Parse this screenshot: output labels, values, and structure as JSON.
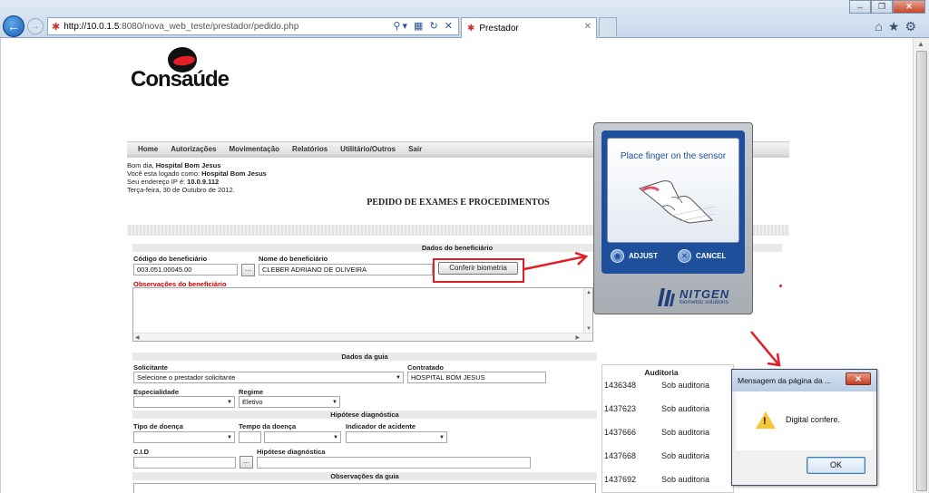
{
  "browser": {
    "url_host": "http://10.0.1.5",
    "url_rest": ":8080/nova_web_teste/prestador/pedido.php",
    "tab_title": "Prestador",
    "tab_close": "✕",
    "icons": [
      "back-arrow",
      "forward-arrow",
      "search",
      "compatibility",
      "refresh",
      "home",
      "favorites",
      "tools"
    ]
  },
  "logo": {
    "text": "Consaúde"
  },
  "nav": [
    "Home",
    "Autorizações",
    "Movimentação",
    "Relatórios",
    "Utilitário/Outros",
    "Sair"
  ],
  "greeting": {
    "line1_prefix": "Bom dia, ",
    "line1_name": "Hospital Bom Jesus",
    "line2_prefix": "Você esta logado como: ",
    "line2_name": "Hospital Bom Jesus",
    "line3_prefix": "Seu endereço IP é: ",
    "line3_ip": "10.0.9.112",
    "line4": "Terça-feira, 30 de Outubro de 2012."
  },
  "page_title": "PEDIDO DE EXAMES E PROCEDIMENTOS",
  "beneficiario": {
    "section_title": "Dados do beneficiário",
    "codigo_label": "Código do beneficiário",
    "codigo_value": "003.051.00045.00",
    "nome_label": "Nome do beneficiário",
    "nome_value": "CLEBER ADRIANO DE OLIVEIRA",
    "dots": "...",
    "verify_button": "Conferir biometria",
    "obs_label": "Observações do beneficiário"
  },
  "guia": {
    "section_title": "Dados da guia",
    "solicitante_label": "Solicitante",
    "solicitante_value": "Selecione o prestador solicitante",
    "contratado_label": "Contratado",
    "contratado_value": "HOSPITAL BOM JESUS",
    "especialidade_label": "Especialidade",
    "regime_label": "Regime",
    "regime_value": "Eletivo"
  },
  "hipotese": {
    "section_title": "Hipótese diagnóstica",
    "tipo_label": "Tipo de doença",
    "tempo_label": "Tempo da doença",
    "indicador_label": "Indicador de acidente",
    "cid_label": "C.I.D",
    "hipotese_label": "Hipótese diagnóstica",
    "dots": "..."
  },
  "obs_guia": {
    "section_title": "Observações da guia"
  },
  "biometric": {
    "prompt": "Place finger on the sensor",
    "adjust": "ADJUST",
    "cancel": "CANCEL",
    "brand": "NITGEN",
    "tagline": "biometric solutions"
  },
  "auditoria": {
    "header": "Auditoria",
    "rows": [
      {
        "num": "1436348",
        "status": "Sob auditoria"
      },
      {
        "num": "1437623",
        "status": "Sob auditoria"
      },
      {
        "num": "1437666",
        "status": "Sob auditoria"
      },
      {
        "num": "1437668",
        "status": "Sob auditoria"
      },
      {
        "num": "1437692",
        "status": "Sob auditoria"
      }
    ]
  },
  "dialog": {
    "title": "Mensagem da página da ...",
    "message": "Digital confere.",
    "ok": "OK",
    "close": "✕"
  },
  "colors": {
    "annotation_red": "#e01e24",
    "nitgen_blue": "#1d4f9a"
  }
}
